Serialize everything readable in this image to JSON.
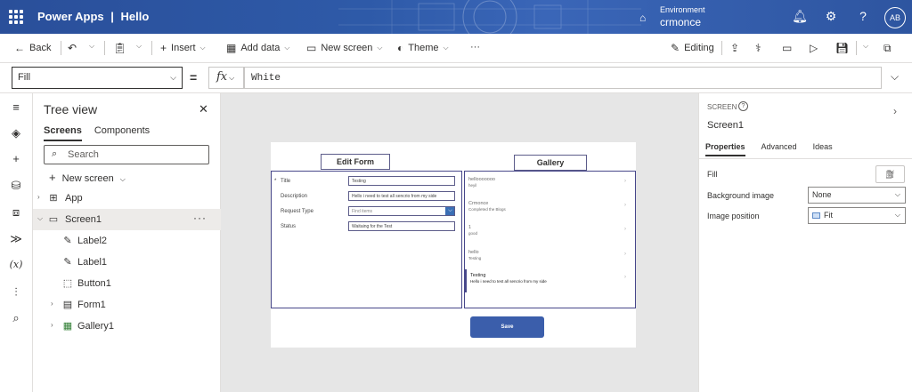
{
  "titlebar": {
    "app": "Power Apps",
    "separator": "|",
    "doc": "Hello",
    "env_label": "Environment",
    "env_name": "crmonce",
    "avatar": "AB"
  },
  "commands": {
    "back": "Back",
    "insert": "Insert",
    "add_data": "Add data",
    "new_screen": "New screen",
    "theme": "Theme",
    "more": "···",
    "editing": "Editing"
  },
  "formula": {
    "property": "Fill",
    "fx": "fx",
    "value": "White"
  },
  "tree": {
    "title": "Tree view",
    "tabs": [
      "Screens",
      "Components"
    ],
    "search_placeholder": "Search",
    "new_screen": "New screen",
    "nodes": [
      {
        "label": "App",
        "icon": "app-icon"
      },
      {
        "label": "Screen1",
        "icon": "screen-icon"
      },
      {
        "label": "Label2",
        "icon": "label-icon"
      },
      {
        "label": "Label1",
        "icon": "label-icon"
      },
      {
        "label": "Button1",
        "icon": "button-icon"
      },
      {
        "label": "Form1",
        "icon": "form-icon"
      },
      {
        "label": "Gallery1",
        "icon": "gallery-icon"
      }
    ],
    "more": "···"
  },
  "canvas": {
    "edit_form_label": "Edit Form",
    "gallery_label": "Gallery",
    "form_fields": [
      {
        "label": "Title",
        "value": "Testing",
        "required": true
      },
      {
        "label": "Description",
        "value": "Hello i need to test all sencrio from my side",
        "required": false
      },
      {
        "label": "Request Type",
        "value": "Find items",
        "required": false
      },
      {
        "label": "Status",
        "value": "Waitaing for the Test",
        "required": false
      }
    ],
    "gallery_items": [
      {
        "title": "hellooooooo",
        "subtitle": "heyil"
      },
      {
        "title": "Crmonce",
        "subtitle": "Completed the Blogs"
      },
      {
        "title": "1",
        "subtitle": "good"
      },
      {
        "title": "hello",
        "subtitle": "Testing"
      },
      {
        "title": "Testing",
        "subtitle": "Hello i need to test all sencrio from my side"
      }
    ],
    "save_button": "Save"
  },
  "properties": {
    "type": "SCREEN",
    "name": "Screen1",
    "tabs": [
      "Properties",
      "Advanced",
      "Ideas"
    ],
    "fill_label": "Fill",
    "background_label": "Background image",
    "background_value": "None",
    "position_label": "Image position",
    "position_value": "Fit"
  },
  "colors": {
    "titlebar": "#2b4a8b",
    "save_button": "#3b5eab",
    "form_border": "#47478a"
  }
}
